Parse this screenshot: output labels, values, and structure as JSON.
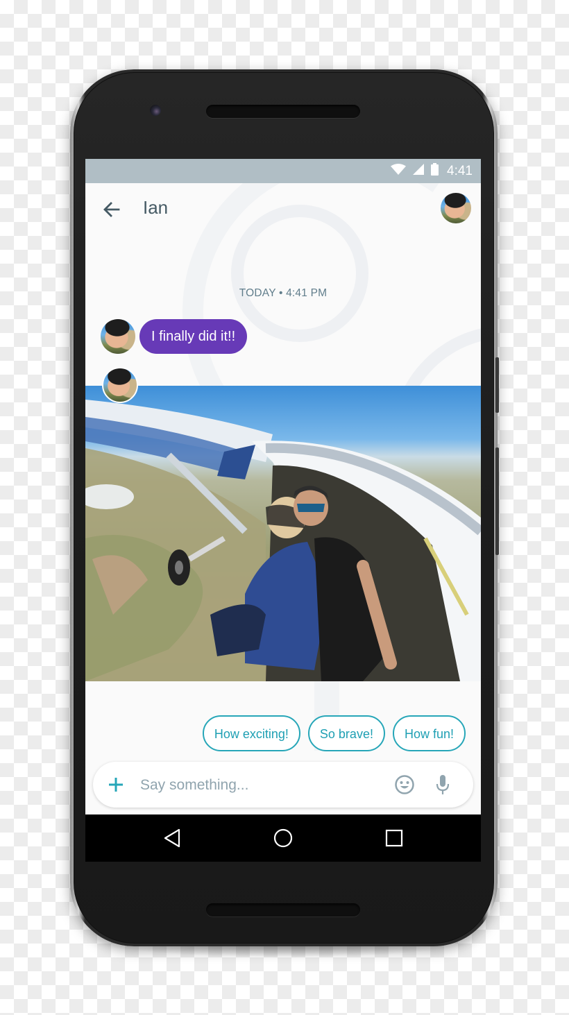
{
  "status_bar": {
    "time": "4:41",
    "icons": [
      "wifi-icon",
      "cellular-signal-icon",
      "battery-icon"
    ]
  },
  "app_bar": {
    "back_icon": "arrow-back-icon",
    "contact_name": "Ian",
    "avatar_alt": "Ian profile photo"
  },
  "conversation": {
    "timestamp": "TODAY • 4:41 PM",
    "messages": [
      {
        "sender": "Ian",
        "type": "text",
        "text": "I finally did it!!"
      },
      {
        "sender": "Ian",
        "type": "photo",
        "description": "Skydiving tandem jump photo taken from airplane door"
      }
    ]
  },
  "smart_replies": [
    "How exciting!",
    "So brave!",
    "How fun!"
  ],
  "compose": {
    "add_icon": "plus-icon",
    "placeholder": "Say something...",
    "value": "",
    "emoji_icon": "emoji-icon",
    "mic_icon": "microphone-icon"
  },
  "nav_bar": {
    "back": "nav-back-icon",
    "home": "nav-home-icon",
    "recents": "nav-recents-icon"
  },
  "colors": {
    "status_bar": "#b0bec5",
    "bubble": "#673ab7",
    "accent": "#26a6b8",
    "title_text": "#455a64",
    "timestamp_text": "#607d8b"
  }
}
